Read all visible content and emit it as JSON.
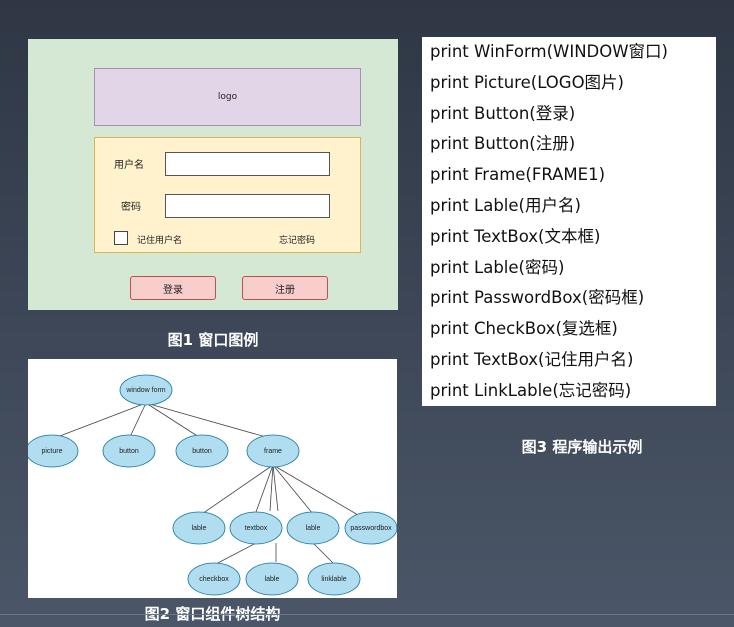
{
  "figure1": {
    "caption": "图1 窗口图例",
    "logo_text": "logo",
    "username_label": "用户名",
    "password_label": "密码",
    "remember_label": "记住用户名",
    "forgot_link": "忘记密码",
    "login_button": "登录",
    "register_button": "注册",
    "colors": {
      "background": "#d5e8d4",
      "logo": "#e1d5e7",
      "frame": "#fff2cc",
      "button": "#f8cecc"
    }
  },
  "figure2": {
    "caption": "图2 窗口组件树结构",
    "nodes": {
      "root": "window form",
      "picture": "picture",
      "button1": "button",
      "button2": "button",
      "frame": "frame",
      "lable1": "lable",
      "textbox1": "textbox",
      "lable2": "lable",
      "passwordbox": "passwordbox",
      "checkbox": "checkbox",
      "lable3": "lable",
      "linklable": "linklable"
    },
    "colors": {
      "node_fill": "#b1ddf0",
      "node_stroke": "#10739e"
    }
  },
  "figure3": {
    "caption": "图3 程序输出示例",
    "lines": [
      "print WinForm(WINDOW窗口)",
      "print Picture(LOGO图片)",
      "print Button(登录)",
      "print Button(注册)",
      "print Frame(FRAME1)",
      "print Lable(用户名)",
      "print TextBox(文本框)",
      "print Lable(密码)",
      "print PasswordBox(密码框)",
      "print CheckBox(复选框)",
      "print TextBox(记住用户名)",
      "print LinkLable(忘记密码)"
    ]
  }
}
